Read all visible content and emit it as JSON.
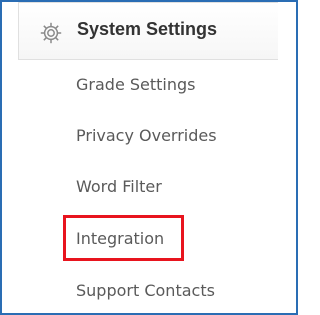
{
  "section": {
    "title": "System Settings",
    "icon": "gear-icon"
  },
  "menu": {
    "items": [
      {
        "label": "Grade Settings"
      },
      {
        "label": "Privacy Overrides"
      },
      {
        "label": "Word Filter"
      },
      {
        "label": "Integration",
        "highlighted": true
      },
      {
        "label": "Support Contacts"
      }
    ]
  },
  "colors": {
    "frame_border": "#2a6db4",
    "highlight_border": "#e8141e",
    "item_text": "#5a5a5a",
    "header_text": "#333333",
    "gear": "#8a8a8a"
  }
}
